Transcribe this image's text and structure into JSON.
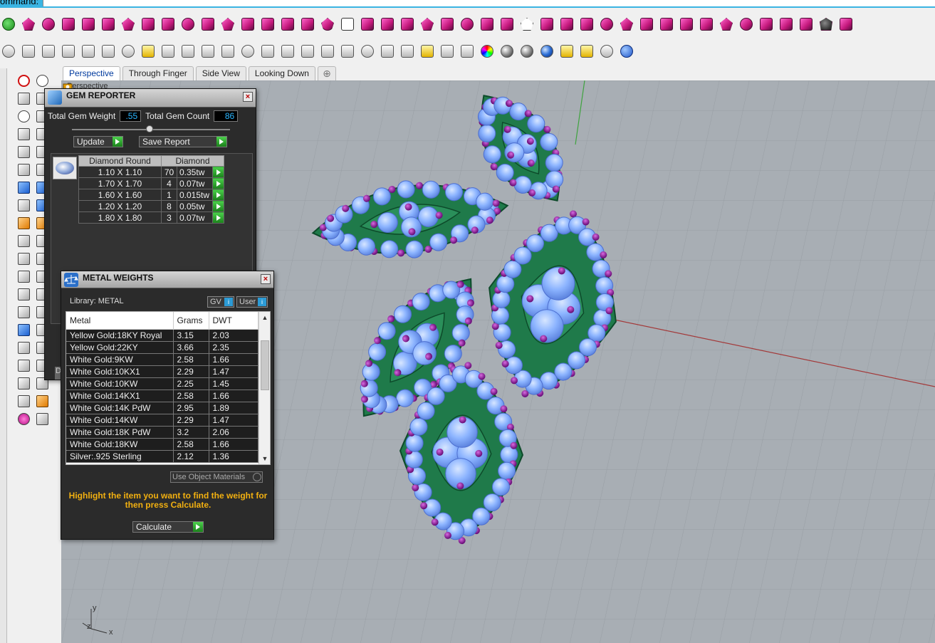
{
  "command_bar": {
    "label": "ommand:"
  },
  "viewport_tabs": [
    {
      "label": "Perspective",
      "active": true
    },
    {
      "label": "Through Finger",
      "active": false
    },
    {
      "label": "Side View",
      "active": false
    },
    {
      "label": "Looking Down",
      "active": false
    }
  ],
  "viewport": {
    "label": "Perspective",
    "background": "#a8aeb4",
    "axis_labels": {
      "y": "y",
      "z": "z",
      "x": "x"
    }
  },
  "gem_reporter": {
    "title": "GEM REPORTER",
    "total_weight_label": "Total Gem Weight",
    "total_weight_value": ".55",
    "total_count_label": "Total Gem Count",
    "total_count_value": "86",
    "update_label": "Update",
    "save_report_label": "Save Report",
    "col_shape": "Diamond Round",
    "col_material": "Diamond",
    "rows": [
      {
        "size": "1.10 X 1.10",
        "count": "70",
        "weight": "0.35tw"
      },
      {
        "size": "1.70 X 1.70",
        "count": "4",
        "weight": "0.07tw"
      },
      {
        "size": "1.60 X 1.60",
        "count": "1",
        "weight": "0.015tw"
      },
      {
        "size": "1.20 X 1.20",
        "count": "8",
        "weight": "0.05tw"
      },
      {
        "size": "1.80 X 1.80",
        "count": "3",
        "weight": "0.07tw"
      }
    ],
    "side_tab": "D"
  },
  "metal_weights": {
    "title": "METAL WEIGHTS",
    "library_label": "Library: METAL",
    "gv_label": "GV",
    "user_label": "User",
    "headers": [
      "Metal",
      "Grams",
      "DWT"
    ],
    "rows": [
      [
        "Yellow Gold:18KY Royal",
        "3.15",
        "2.03"
      ],
      [
        "Yellow Gold:22KY",
        "3.66",
        "2.35"
      ],
      [
        "White Gold:9KW",
        "2.58",
        "1.66"
      ],
      [
        "White Gold:10KX1",
        "2.29",
        "1.47"
      ],
      [
        "White Gold:10KW",
        "2.25",
        "1.45"
      ],
      [
        "White Gold:14KX1",
        "2.58",
        "1.66"
      ],
      [
        "White Gold:14K PdW",
        "2.95",
        "1.89"
      ],
      [
        "White Gold:14KW",
        "2.29",
        "1.47"
      ],
      [
        "White Gold:18K PdW",
        "3.2",
        "2.06"
      ],
      [
        "White Gold:18KW",
        "2.58",
        "1.66"
      ],
      [
        "Silver:.925 Sterling",
        "2.12",
        "1.36"
      ]
    ],
    "use_object_label": "Use Object Materials",
    "hint": "Highlight the item you want to find the weight for then press Calculate.",
    "calculate_label": "Calculate"
  },
  "colors": {
    "accent_blue": "#3ab4e2",
    "gem_blue": "#8cb4ff",
    "prong_purple": "#8a1a9a",
    "metal_green": "#1f7a4a",
    "hint_yellow": "#f2b010"
  }
}
